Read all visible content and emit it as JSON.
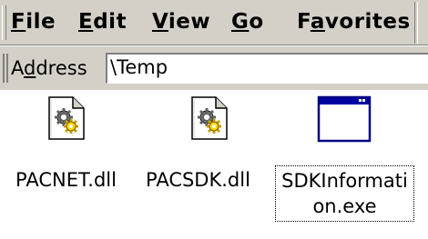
{
  "menu": {
    "items": [
      {
        "accel": "F",
        "rest": "ile"
      },
      {
        "accel": "E",
        "rest": "dit"
      },
      {
        "accel": "V",
        "rest": "iew"
      },
      {
        "accel": "G",
        "rest": "o"
      },
      {
        "pre": "F",
        "accel": "a",
        "rest": "vorites"
      }
    ]
  },
  "address": {
    "label_pre": "A",
    "label_accel": "d",
    "label_rest": "dress",
    "value": "\\Temp"
  },
  "files": [
    {
      "name": "PACNET.dll",
      "icon": "dll-settings-icon"
    },
    {
      "name": "PACSDK.dll",
      "icon": "dll-settings-icon"
    },
    {
      "name": "SDKInformati on.exe",
      "line1": "SDKInformati",
      "line2": "on.exe",
      "icon": "application-window-icon",
      "selected": true
    }
  ]
}
